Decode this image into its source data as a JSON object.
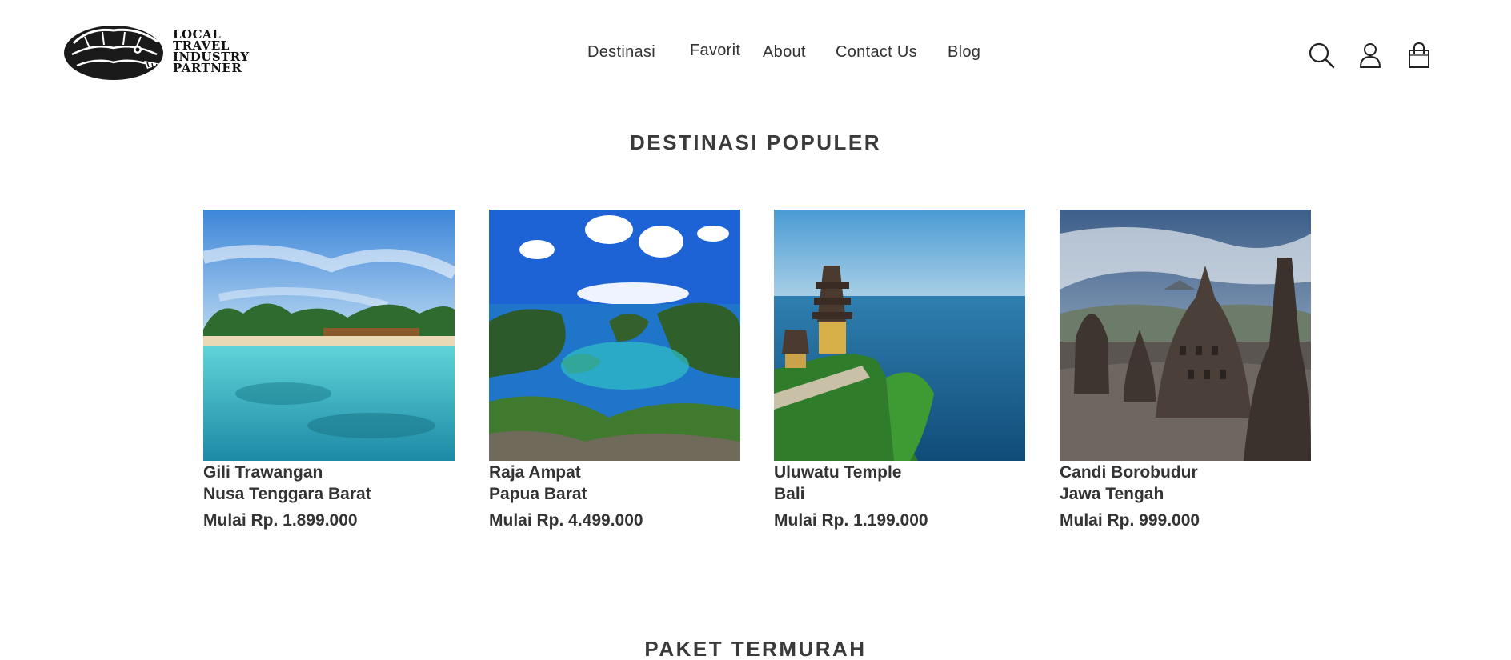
{
  "header": {
    "logo": {
      "line1": "LOCAL",
      "line2": "TRAVEL",
      "line3": "INDUSTRY",
      "line4": "PARTNER"
    },
    "nav": [
      {
        "label": "Destinasi"
      },
      {
        "label": "Favorit"
      },
      {
        "label": "About"
      },
      {
        "label": "Contact Us"
      },
      {
        "label": "Blog"
      }
    ],
    "icons": [
      "search-icon",
      "user-icon",
      "shopping-bag-icon"
    ]
  },
  "sections": {
    "popular_title": "DESTINASI POPULER",
    "cheapest_title": "PAKET TERMURAH"
  },
  "destinations": [
    {
      "name": "Gili Trawangan",
      "region": "Nusa Tenggara Barat",
      "price": "Mulai Rp. 1.899.000"
    },
    {
      "name": "Raja Ampat",
      "region": "Papua Barat",
      "price": "Mulai Rp. 4.499.000"
    },
    {
      "name": "Uluwatu Temple",
      "region": "Bali",
      "price": "Mulai Rp. 1.199.000"
    },
    {
      "name": "Candi Borobudur",
      "region": "Jawa Tengah",
      "price": "Mulai Rp. 999.000"
    }
  ],
  "colors": {
    "text": "#333333",
    "title": "#3a3a3a",
    "background": "#ffffff"
  }
}
